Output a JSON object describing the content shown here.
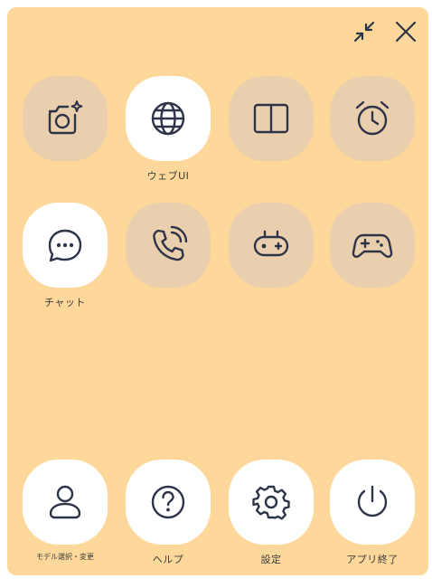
{
  "window": {
    "minimize_icon": "collapse-arrows-icon",
    "close_icon": "close-icon"
  },
  "apps": [
    {
      "icon": "camera-sparkle-icon",
      "label": "",
      "active": false
    },
    {
      "icon": "globe-icon",
      "label": "ウェブUI",
      "active": true
    },
    {
      "icon": "book-icon",
      "label": "",
      "active": false
    },
    {
      "icon": "alarm-clock-icon",
      "label": "",
      "active": false
    },
    {
      "icon": "chat-bubble-icon",
      "label": "チャット",
      "active": true
    },
    {
      "icon": "phone-call-icon",
      "label": "",
      "active": false
    },
    {
      "icon": "gamepad-icon",
      "label": "",
      "active": false
    },
    {
      "icon": "game-controller-icon",
      "label": "",
      "active": false
    }
  ],
  "bottom": [
    {
      "icon": "user-icon",
      "label": "モデル選択・変更"
    },
    {
      "icon": "help-icon",
      "label": "ヘルプ"
    },
    {
      "icon": "settings-gear-icon",
      "label": "設定"
    },
    {
      "icon": "power-icon",
      "label": "アプリ終了"
    }
  ],
  "colors": {
    "panel": "#fdd89a",
    "tile_inactive": "#e9cfae",
    "tile_active": "#ffffff",
    "icon": "#2e3448"
  }
}
